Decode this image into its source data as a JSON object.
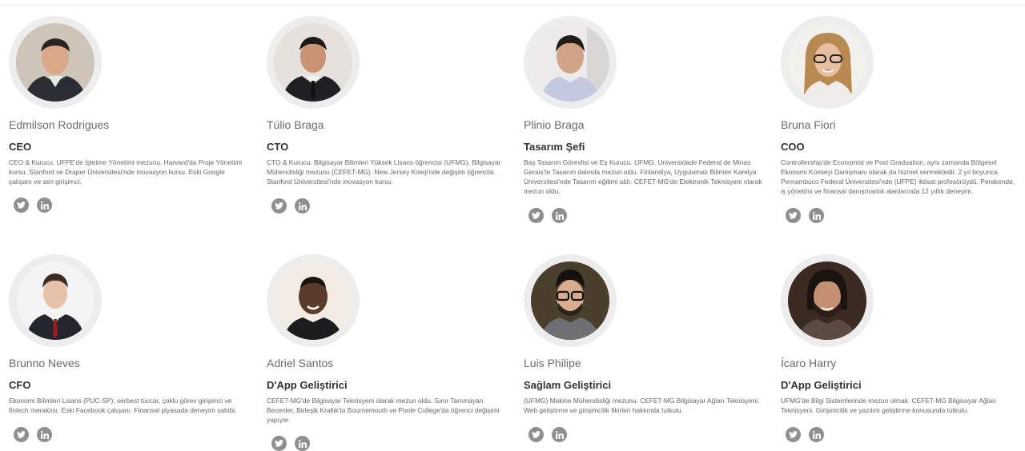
{
  "team": [
    {
      "name": "Edmilson Rodrigues",
      "role": "CEO",
      "bio": "CEO & Kurucu. UFPE'de İşletme Yönetimi mezunu. Harvard'da Proje Yönetimi kursu. Stanford ve Draper Üniversitesi'nde inovasyon kursu. Eski Google çalışanı ve seri girişimci.",
      "social": [
        "twitter-icon",
        "linkedin-icon"
      ]
    },
    {
      "name": "Túlio Braga",
      "role": "CTO",
      "bio": "CTO & Kurucu. Bilgisayar Bilimleri Yüksek Lisans öğrencisi (UFMG). Bilgisayar Mühendisliği mezunu (CEFET-MG). New Jersey Koleji'nde değişim öğrencisi. Stanford Üniversitesi'nde inovasyon kursu.",
      "social": [
        "twitter-icon",
        "linkedin-icon"
      ]
    },
    {
      "name": "Plinio Braga",
      "role": "Tasarım Şefi",
      "bio": "Baş Tasarım Görevlisi ve Eş Kurucu. UFMG, Universidade Federal de Minas Gerais'te Tasarım dalında mezun oldu. Finlandiya, Uygulamalı Bilimler Karelya Üniversitesi'nde Tasarım eğitimi aldı. CEFET-MG'de Elektronik Teknisyeni olarak mezun oldu.",
      "social": [
        "twitter-icon",
        "linkedin-icon"
      ]
    },
    {
      "name": "Bruna Fiori",
      "role": "COO",
      "bio": "Controllership'de Economist ve Post Graduation, aynı zamanda Bölgesel Ekonomi Konseyi Danışmanı olarak da hizmet vermektedir. 2 yıl boyunca Pernambuco Federal Üniversitesi'nde (UFPE) iktisat profesörüydü. Perakende, iş yönetimi ve finansal danışmanlık alanlarında 12 yıllık deneyim.",
      "social": [
        "twitter-icon",
        "linkedin-icon"
      ]
    },
    {
      "name": "Brunno Neves",
      "role": "CFO",
      "bio": "Ekonomi Bilimleri Lisans (PUC-SP), serbest tüccar, çoklu görev girişimci ve fintech meraklısı. Eski Facebook çalışanı. Finansal piyasada deneyim sahibi.",
      "social": [
        "twitter-icon",
        "linkedin-icon"
      ]
    },
    {
      "name": "Adriel Santos",
      "role": "D'App Geliştirici",
      "bio": "CEFET-MG'de Bilgisayar Teknisyeni olarak mezun oldu. Sınır Tanımayan Beceriler, Birleşik Krallık'ta Bournemouth ve Poole College'da öğrenci değişimi yapıyor.",
      "social": [
        "twitter-icon",
        "linkedin-icon"
      ]
    },
    {
      "name": "Luis Philipe",
      "role": "Sağlam Geliştirici",
      "bio": "(UFMG) Makine Mühendisliği mezunu. CEFET-MG Bilgisayar Ağları Teknisyeni. Web geliştirme ve girişimcilik fikirleri hakkında tutkulu.",
      "social": [
        "twitter-icon",
        "linkedin-icon"
      ]
    },
    {
      "name": "Ícaro Harry",
      "role": "D'App Geliştirici",
      "bio": "UFMG'de Bilgi Sistemlerinde mezun olmak. CEFET-MG Bilgisayar Ağları Teknisyeni. Girişimcilik ve yazılım geliştirme konusunda tutkulu.",
      "social": [
        "twitter-icon",
        "linkedin-icon"
      ]
    }
  ],
  "colors": {
    "name": "#6b6b6b",
    "role": "#333333",
    "bio": "#666666",
    "social_button": "#8f8f8f",
    "avatar_ring": "#ededed"
  }
}
